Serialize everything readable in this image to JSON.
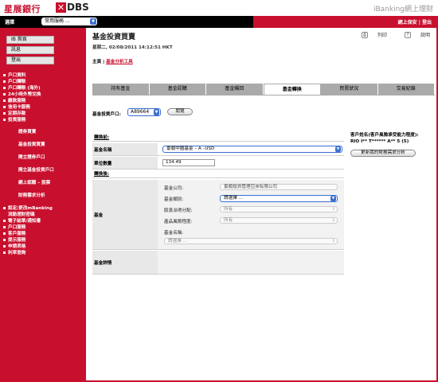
{
  "brand": {
    "logo_zh": "星展銀行",
    "logo_x": "✕",
    "logo_dbs": "DBS",
    "ibanking": "iBanking網上理財"
  },
  "topbar": {
    "select_label": "選擇",
    "quick_select": "常用服務 ...",
    "logout": "網上保安 | 登出"
  },
  "sidebar": {
    "boxes": [
      "IB 首頁",
      "訊息",
      "登出"
    ],
    "items": [
      "戶口資料",
      "戶口轉賬",
      "戶口轉賬 (海外)",
      "24小時外幣兌換",
      "繳款服務",
      "信用卡服務",
      "定期存款",
      "投資服務"
    ],
    "subitems": [
      "證券買賣",
      "基金投資買賣",
      "開立證券戶口",
      "開立基金投資戶口",
      "網上認購 – 股票",
      "財務需求分析"
    ],
    "items_lower": [
      "設定/更改mBanking",
      "流動理財密碼",
      "電子結單/通知書",
      "戶口服務",
      "客戶服務",
      "提示服務",
      "申請表格",
      "利率查詢"
    ]
  },
  "main": {
    "title": "基金投資買賣",
    "datetime": "星期二, 02/08/2011 14:12:51 HKT",
    "print": "列印",
    "help": "說明",
    "crumb_home": "主頁",
    "crumb_sep": " | ",
    "crumb_link": "基金分析工具",
    "tabs": [
      "持有基金",
      "基金認購",
      "基金贖回",
      "基金轉換",
      "買賣狀況",
      "交易紀錄"
    ],
    "active_tab": 3
  },
  "account": {
    "label": "基金投資戶口:",
    "value": "A89664",
    "browse": "閱覽"
  },
  "form": {
    "from_section": "轉換前:",
    "fund_name_label": "基金名稱",
    "fund_name_value": "景順中國基金 – A –USD",
    "units_label": "單位數量",
    "units_value": "134.49",
    "to_section": "轉換後:",
    "fund_label": "基金",
    "company_label": "基金公司:",
    "company_value": "景順投資管理亞洲有限公司",
    "category_label": "基金類別:",
    "category_value": "請選擇 ...",
    "dividend_label": "股息派得分配:",
    "dividend_value": "所有",
    "risk_label": "產品風險程度:",
    "risk_value": "所有",
    "fundname2_label": "基金名稱:",
    "fundname2_value": "請選擇 ...",
    "details_label": "基金詳情"
  },
  "side": {
    "title": "客戶姓名(客戶風險承受能力程度):",
    "name": "RIO I** T****** A** 5 (5)",
    "update_button": "更新我的財務需求分析"
  },
  "colors": {
    "brand_red": "#c8102e",
    "select_blue": "#3a6fd1",
    "label_grey": "#e8e8e8"
  }
}
